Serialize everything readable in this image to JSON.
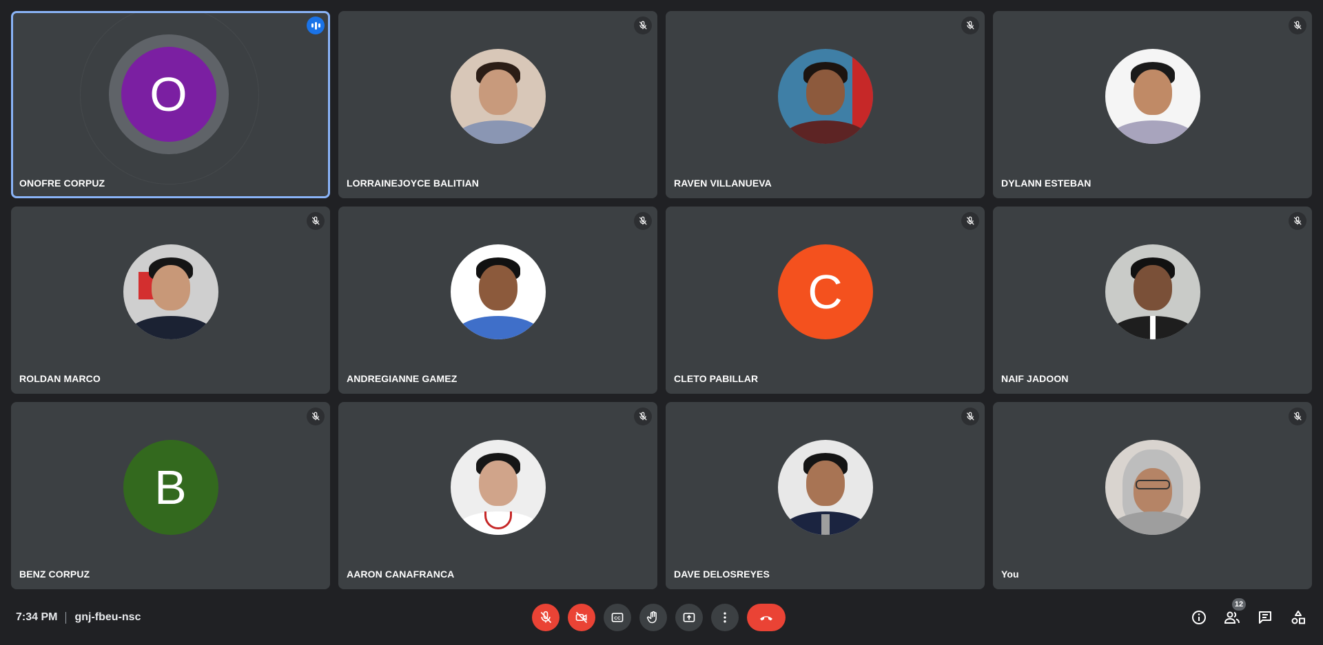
{
  "participants": [
    {
      "name": "ONOFRE CORPUZ",
      "avatar_type": "letter",
      "letter": "O",
      "avatar_color": "#7b1fa2",
      "speaking": true
    },
    {
      "name": "LORRAINEJOYCE BALITIAN",
      "avatar_type": "photo",
      "muted": true
    },
    {
      "name": "RAVEN VILLANUEVA",
      "avatar_type": "photo",
      "muted": true
    },
    {
      "name": "DYLANN ESTEBAN",
      "avatar_type": "photo",
      "muted": true
    },
    {
      "name": "ROLDAN MARCO",
      "avatar_type": "photo",
      "muted": true
    },
    {
      "name": "ANDREGIANNE GAMEZ",
      "avatar_type": "photo",
      "muted": true
    },
    {
      "name": "CLETO PABILLAR",
      "avatar_type": "letter",
      "letter": "C",
      "avatar_color": "#f4511e",
      "muted": true
    },
    {
      "name": "NAIF JADOON",
      "avatar_type": "photo",
      "muted": true
    },
    {
      "name": "BENZ CORPUZ",
      "avatar_type": "letter",
      "letter": "B",
      "avatar_color": "#33691e",
      "muted": true
    },
    {
      "name": "AARON CANAFRANCA",
      "avatar_type": "photo",
      "muted": true
    },
    {
      "name": "DAVE DELOSREYES",
      "avatar_type": "photo",
      "muted": true
    },
    {
      "name": "You",
      "avatar_type": "photo",
      "muted": true
    }
  ],
  "bottom_bar": {
    "time": "7:34 PM",
    "meeting_code": "gnj-fbeu-nsc",
    "controls": [
      "mic-off-icon",
      "camera-off-icon",
      "captions-icon",
      "raise-hand-icon",
      "present-icon",
      "more-options-icon",
      "end-call-icon"
    ],
    "right_controls": [
      "info-icon",
      "people-icon",
      "chat-icon",
      "activities-icon"
    ],
    "people_count": "12"
  },
  "colors": {
    "background": "#202124",
    "tile": "#3c4043",
    "active_border": "#8ab4f8",
    "danger": "#ea4335",
    "speaking": "#1a73e8"
  }
}
